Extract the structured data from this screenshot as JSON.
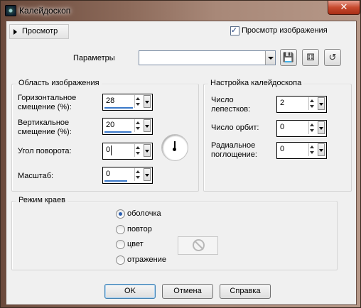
{
  "window": {
    "title": "Калейдоскоп",
    "close_label": "✕"
  },
  "preview": {
    "toggle_label": "Просмотр",
    "checkbox_label": "Просмотр изображения",
    "checkbox_checked": true
  },
  "presets": {
    "label": "Параметры",
    "value": ""
  },
  "image_area": {
    "title": "Область изображения",
    "h_offset_label_1": "Горизонтальное",
    "h_offset_label_2": "смещение (%):",
    "h_offset_value": "28",
    "v_offset_label_1": "Вертикальное",
    "v_offset_label_2": "смещение (%):",
    "v_offset_value": "20",
    "rotation_label": "Угол поворота:",
    "rotation_value": "0",
    "scale_label": "Масштаб:",
    "scale_value": "0"
  },
  "kaleido": {
    "title": "Настройка калейдоскопа",
    "petals_label_1": "Число",
    "petals_label_2": "лепестков:",
    "petals_value": "2",
    "orbits_label": "Число орбит:",
    "orbits_value": "0",
    "radial_label_1": "Радиальное",
    "radial_label_2": "поглощение:",
    "radial_value": "0"
  },
  "edge_mode": {
    "title": "Режим краев",
    "options": [
      "оболочка",
      "повтор",
      "цвет",
      "отражение"
    ],
    "selected": "оболочка"
  },
  "buttons": {
    "ok": "OK",
    "cancel": "Отмена",
    "help": "Справка"
  }
}
